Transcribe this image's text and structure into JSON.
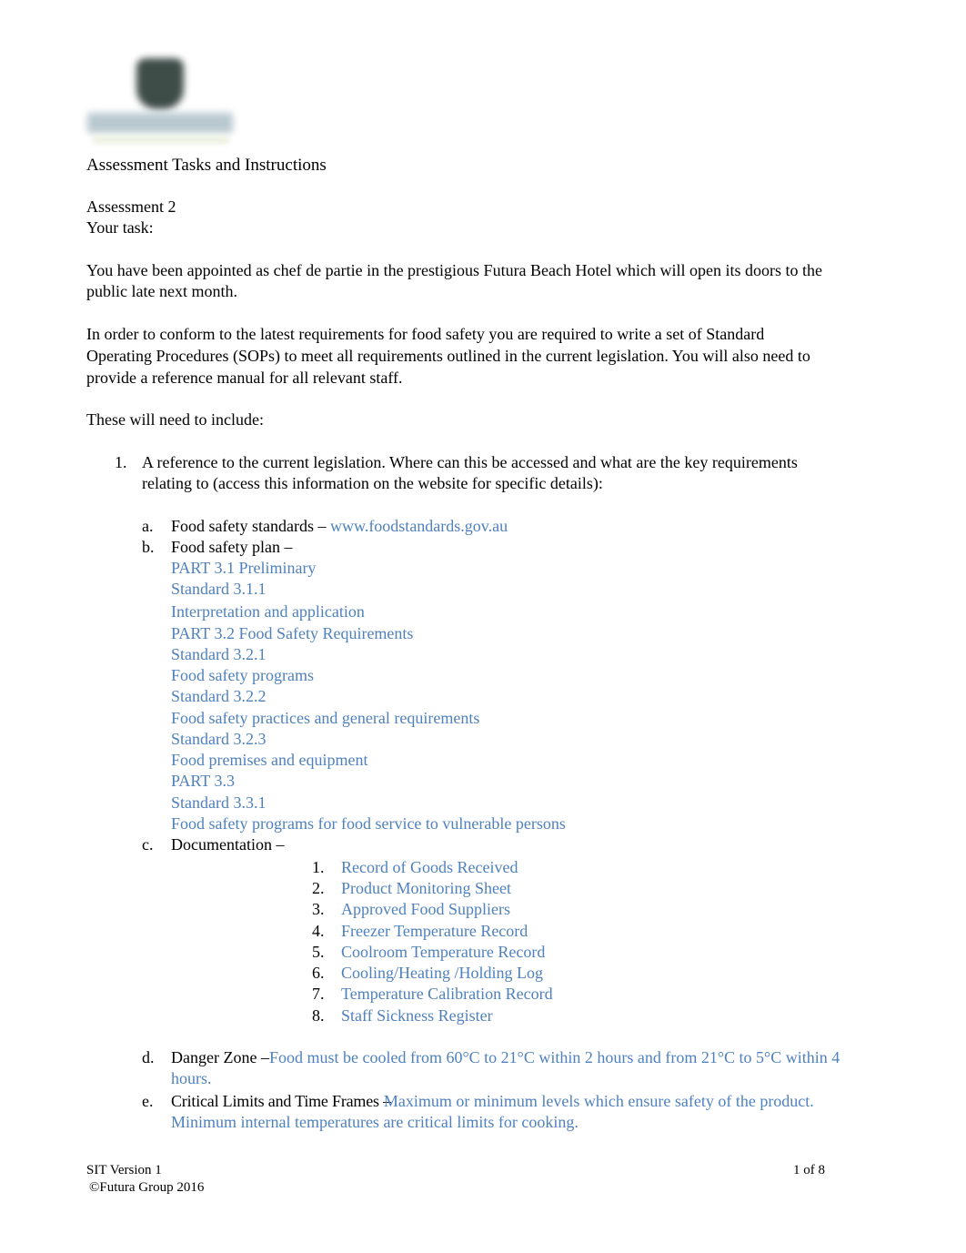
{
  "header": {
    "logo_icon": "futura-group-logo",
    "title": "Assessment Tasks and Instructions"
  },
  "intro": {
    "assessment": "Assessment 2",
    "task_label": "Your task:",
    "para1_line1": "You have been appointed as chef de partie in the prestigious Futura Beach Hotel which will open its doors to the",
    "para1_line2": "public late next month.",
    "para2_line1": "In order to conform to the latest requirements for food safety you are required to write a set of Standard",
    "para2_line2": "Operating Procedures (SOPs) to meet all requirements outlined in the current legislation. You will also need to",
    "para2_line3": "provide a reference manual for all relevant staff.",
    "para3": "These will need to include:"
  },
  "item1": {
    "number": "1.",
    "line1": "A reference to the current legislation. Where can this be accessed and what are the key requirements",
    "line2": "relating to (access this information on the website for specific details):"
  },
  "sub_a": {
    "marker": "a.",
    "label": "Food safety standards – ",
    "link": "www.foodstandards.gov.au"
  },
  "sub_b": {
    "marker": "b.",
    "label": "Food safety plan –",
    "lines": [
      "PART 3.1 Preliminary",
      "Standard 3.1.1",
      "Interpretation and application",
      "PART 3.2 Food Safety Requirements",
      "Standard 3.2.1",
      "Food safety programs",
      "Standard 3.2.2",
      "Food safety practices and general requirements",
      "Standard 3.2.3",
      "Food premises and equipment",
      "PART 3.3",
      "Standard 3.3.1",
      "Food safety programs for food service to vulnerable persons"
    ]
  },
  "sub_c": {
    "marker": "c.",
    "label": "Documentation –",
    "items": [
      {
        "num": "1.",
        "text": "Record of Goods Received"
      },
      {
        "num": "2.",
        "text": "Product Monitoring Sheet"
      },
      {
        "num": "3.",
        "text": "Approved Food Suppliers"
      },
      {
        "num": "4.",
        "text": "Freezer Temperature Record"
      },
      {
        "num": "5.",
        "text": "Coolroom Temperature Record"
      },
      {
        "num": "6.",
        "text": "Cooling/Heating /Holding Log"
      },
      {
        "num": "7.",
        "text": "Temperature Calibration Record"
      },
      {
        "num": "8.",
        "text": "Staff Sickness Register"
      }
    ]
  },
  "sub_d": {
    "marker": "d.",
    "label": "Danger Zone –",
    "answer_line1": "Food must be cooled from 60°C to 21°C within 2 hours and from 21°C to 5°C within 4",
    "answer_line2": "hours."
  },
  "sub_e": {
    "marker": "e.",
    "label": "Critical Limits and Time Frames –",
    "answer_line1": "Maximum or minimum levels which ensure safety of the product.",
    "answer_line2": "Minimum internal temperatures are critical limits for cooking."
  },
  "footer": {
    "version": "SIT Version 1",
    "copyright": "©Futura Group 2016",
    "page": "1 of 8"
  },
  "colors": {
    "answer_text": "#4f81bd",
    "body_text": "#000000"
  }
}
